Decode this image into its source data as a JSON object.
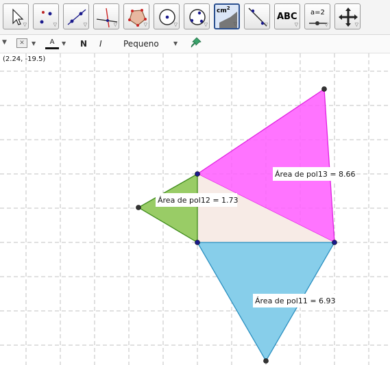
{
  "toolbar": {
    "tools": [
      {
        "name": "move-tool-button",
        "icon": "arrow-pointer-icon"
      },
      {
        "name": "point-tool-button",
        "icon": "point-icon"
      },
      {
        "name": "line-tool-button",
        "icon": "line-through-points-icon"
      },
      {
        "name": "perpendicular-tool-button",
        "icon": "perpendicular-line-icon"
      },
      {
        "name": "polygon-tool-button",
        "icon": "polygon-icon"
      },
      {
        "name": "circle-tool-button",
        "icon": "circle-center-point-icon"
      },
      {
        "name": "circle-three-points-tool-button",
        "icon": "circle-three-points-icon"
      },
      {
        "name": "area-tool-button",
        "icon": "area-measure-icon",
        "text": "cm",
        "sup": "2",
        "selected": true
      },
      {
        "name": "reflect-tool-button",
        "icon": "reflect-about-line-icon"
      },
      {
        "name": "text-tool-button",
        "icon": "text-icon",
        "text": "ABC"
      },
      {
        "name": "slider-tool-button",
        "icon": "slider-icon",
        "text": "a=2"
      },
      {
        "name": "move-graphics-view-tool-button",
        "icon": "move-view-icon"
      }
    ]
  },
  "stylebar": {
    "color_label": "A",
    "bold_label": "N",
    "italic_label": "I",
    "size_label": "Pequeno"
  },
  "coords_text": "(2.24, -19.5)",
  "colors": {
    "pink": "#ff5cff",
    "green": "#99cc66",
    "blue": "#87ceea",
    "beige": "#f7ebe6",
    "point_blue": "#1a1a8c",
    "point_dark": "#333333"
  },
  "labels": {
    "pol13": "Área de pol13 = 8.66",
    "pol12": "Área de pol12 = 1.73",
    "pol11": "Área de pol11 = 6.93"
  }
}
